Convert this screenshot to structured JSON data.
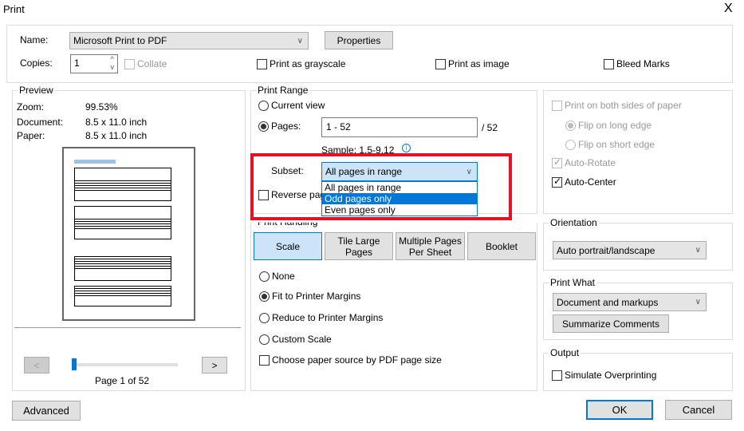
{
  "window": {
    "title": "Print",
    "close": "X"
  },
  "printer": {
    "name_label": "Name:",
    "name_value": "Microsoft Print to PDF",
    "properties": "Properties",
    "copies_label": "Copies:",
    "copies_value": "1",
    "collate": "Collate",
    "grayscale": "Print as grayscale",
    "as_image": "Print as image",
    "bleed": "Bleed Marks"
  },
  "preview": {
    "title": "Preview",
    "zoom_label": "Zoom:",
    "zoom_value": "99.53%",
    "doc_label": "Document:",
    "doc_value": "8.5 x 11.0 inch",
    "paper_label": "Paper:",
    "paper_value": "8.5 x 11.0 inch",
    "prev": "<",
    "next": ">",
    "page_status": "Page 1 of 52",
    "slider_value": 1,
    "slider_max": 52
  },
  "range": {
    "title": "Print Range",
    "current_view": "Current view",
    "pages_label": "Pages:",
    "pages_value": "1 - 52",
    "pages_total": "/ 52",
    "sample": "Sample: 1,5-9,12",
    "subset_label": "Subset:",
    "subset_value": "All pages in range",
    "subset_options": [
      "All pages in range",
      "Odd pages only",
      "Even pages only"
    ],
    "reverse": "Reverse pages"
  },
  "handling": {
    "title": "Print Handling",
    "tabs": [
      "Scale",
      "Tile Large Pages",
      "Multiple Pages Per Sheet",
      "Booklet"
    ],
    "none": "None",
    "fit": "Fit to Printer Margins",
    "reduce": "Reduce to Printer Margins",
    "custom": "Custom Scale",
    "paper_source": "Choose paper source by PDF page size"
  },
  "duplex": {
    "both_sides": "Print on both sides of paper",
    "long_edge": "Flip on long edge",
    "short_edge": "Flip on short edge",
    "auto_rotate": "Auto-Rotate",
    "auto_center": "Auto-Center"
  },
  "orientation": {
    "title": "Orientation",
    "value": "Auto portrait/landscape"
  },
  "what": {
    "title": "Print What",
    "value": "Document and markups",
    "summarize": "Summarize Comments"
  },
  "output": {
    "title": "Output",
    "simulate": "Simulate Overprinting"
  },
  "footer": {
    "advanced": "Advanced",
    "ok": "OK",
    "cancel": "Cancel"
  },
  "colors": {
    "highlight": "#0078d7",
    "annotation": "#e81123"
  }
}
